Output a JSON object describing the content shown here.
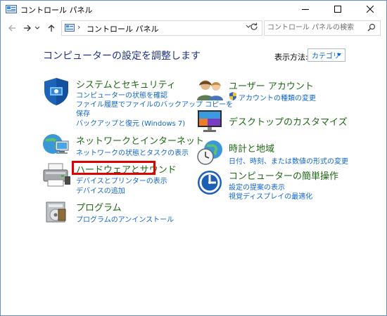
{
  "window": {
    "title": "コントロール パネル",
    "minimize_icon": "minimize-icon",
    "maximize_icon": "maximize-icon",
    "close_icon": "close-icon"
  },
  "nav": {
    "back_icon": "back-arrow-icon",
    "forward_icon": "forward-arrow-icon",
    "recent_icon": "chevron-down-icon",
    "up_icon": "up-arrow-icon",
    "address_path": "コントロール パネル",
    "refresh_icon": "refresh-icon",
    "search_placeholder": "コントロール パネルの検索"
  },
  "header": {
    "title": "コンピューターの設定を調整します",
    "view_by_label": "表示方法:",
    "view_by_value": "カテゴリ"
  },
  "categories_left": [
    {
      "title": "システムとセキュリティ",
      "links": [
        "コンピューターの状態を確認",
        "ファイル履歴でファイルのバックアップ コピーを",
        "保存",
        "バックアップと復元 (Windows 7)"
      ]
    },
    {
      "title": "ネットワークとインターネット",
      "links": [
        "ネットワークの状態とタスクの表示"
      ]
    },
    {
      "title": "ハードウェアとサウンド",
      "links": [
        "デバイスとプリンターの表示",
        "デバイスの追加"
      ]
    },
    {
      "title": "プログラム",
      "links": [
        "プログラムのアンインストール"
      ]
    }
  ],
  "categories_right": [
    {
      "title": "ユーザー アカウント",
      "links": [
        "アカウントの種類の変更"
      ]
    },
    {
      "title": "デスクトップのカスタマイズ",
      "links": []
    },
    {
      "title": "時計と地域",
      "links": [
        "日付、時刻、または数値の形式の変更"
      ]
    },
    {
      "title": "コンピューターの簡単操作",
      "links": [
        "設定の提案の表示",
        "視覚ディスプレイの最適化"
      ]
    }
  ],
  "colors": {
    "category_title": "#1c6a13",
    "link": "#1066cc",
    "page_title": "#1e3287",
    "highlight": "#e10000"
  }
}
